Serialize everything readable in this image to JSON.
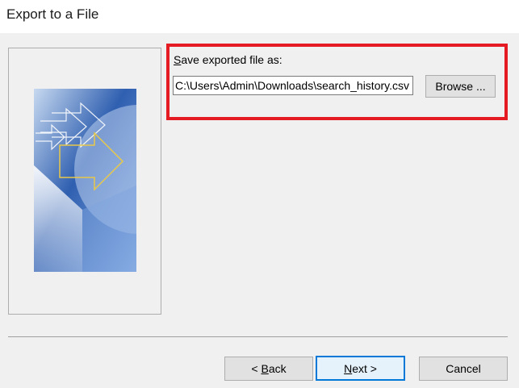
{
  "window": {
    "title": "Export to a File"
  },
  "form": {
    "label_underlined": "S",
    "label_rest": "ave exported file as:",
    "path_value": "C:\\Users\\Admin\\Downloads\\search_history.csv",
    "browse_label": "Browse ..."
  },
  "footer": {
    "back_prefix": "< ",
    "back_underlined": "B",
    "back_rest": "ack",
    "next_underlined": "N",
    "next_rest": "ext >",
    "cancel_label": "Cancel"
  },
  "colors": {
    "highlight": "#e51b23",
    "default_button_border": "#0078d7",
    "art_blue": "#2f5fb0"
  }
}
